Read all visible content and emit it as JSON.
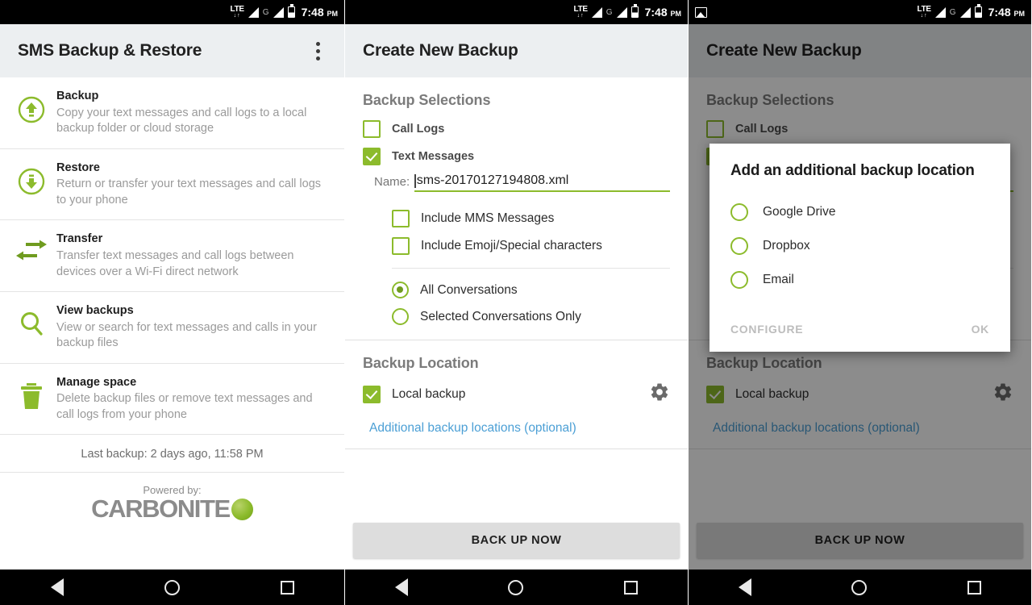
{
  "colors": {
    "accent_green": "#8cbb2c",
    "link_blue": "#4b9fd5",
    "appbar_bg": "#eceff1",
    "cta_bg": "#dddddd"
  },
  "statusbar": {
    "time": "7:48",
    "meridiem": "PM",
    "lte_label": "LTE",
    "lte_arrows": "↓↑",
    "g_label": "G",
    "photo_icon": "photo-icon"
  },
  "screen1": {
    "appbar": {
      "title": "SMS Backup & Restore",
      "overflow_label": "overflow-menu"
    },
    "items": [
      {
        "icon": "backup-up-arrow-icon",
        "title": "Backup",
        "subtitle": "Copy your text messages and call logs to a local backup folder or cloud storage"
      },
      {
        "icon": "restore-down-arrow-icon",
        "title": "Restore",
        "subtitle": "Return or transfer your text messages and call logs to your phone"
      },
      {
        "icon": "transfer-arrows-icon",
        "title": "Transfer",
        "subtitle": "Transfer text messages and call logs between devices over a Wi-Fi direct network"
      },
      {
        "icon": "magnifier-icon",
        "title": "View backups",
        "subtitle": "View or search for text messages and calls in your backup files"
      },
      {
        "icon": "trash-icon",
        "title": "Manage space",
        "subtitle": "Delete backup files or remove text messages and call logs from your phone"
      }
    ],
    "last_backup": "Last backup: 2 days ago, 11:58 PM",
    "footer": {
      "powered_by": "Powered by:",
      "brand": "CARBONITE"
    }
  },
  "screen2": {
    "appbar": {
      "title": "Create New Backup"
    },
    "selections_heading": "Backup Selections",
    "call_logs": {
      "label": "Call Logs",
      "checked": false
    },
    "text_messages": {
      "label": "Text Messages",
      "checked": true
    },
    "name_field": {
      "label": "Name:",
      "value": "sms-20170127194808.xml"
    },
    "include_mms": {
      "label": "Include MMS Messages",
      "checked": false
    },
    "include_emoji": {
      "label": "Include Emoji/Special characters",
      "checked": false
    },
    "conversations": [
      {
        "label": "All Conversations",
        "selected": true
      },
      {
        "label": "Selected Conversations Only",
        "selected": false
      }
    ],
    "location_heading": "Backup Location",
    "local_backup": {
      "label": "Local backup",
      "checked": true
    },
    "gear_icon": "gear-icon",
    "additional_locations_link": "Additional backup locations (optional)",
    "cta_label": "BACK UP NOW"
  },
  "screen3": {
    "appbar": {
      "title": "Create New Backup"
    },
    "dialog": {
      "title": "Add an additional backup location",
      "options": [
        {
          "label": "Google Drive",
          "selected": false
        },
        {
          "label": "Dropbox",
          "selected": false
        },
        {
          "label": "Email",
          "selected": false
        }
      ],
      "configure_label": "CONFIGURE",
      "ok_label": "OK"
    }
  },
  "navbar": {
    "back": "back-nav-icon",
    "home": "home-nav-icon",
    "recents": "recents-nav-icon"
  }
}
